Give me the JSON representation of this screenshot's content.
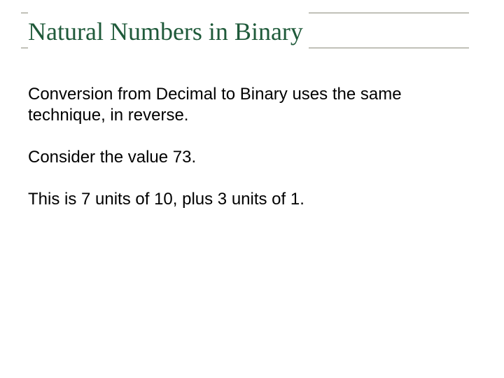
{
  "slide": {
    "title": "Natural Numbers in Binary",
    "paragraphs": [
      "Conversion from Decimal to Binary uses the same technique, in reverse.",
      "Consider the value 73.",
      "This is 7 units of 10, plus 3 units of 1."
    ]
  }
}
